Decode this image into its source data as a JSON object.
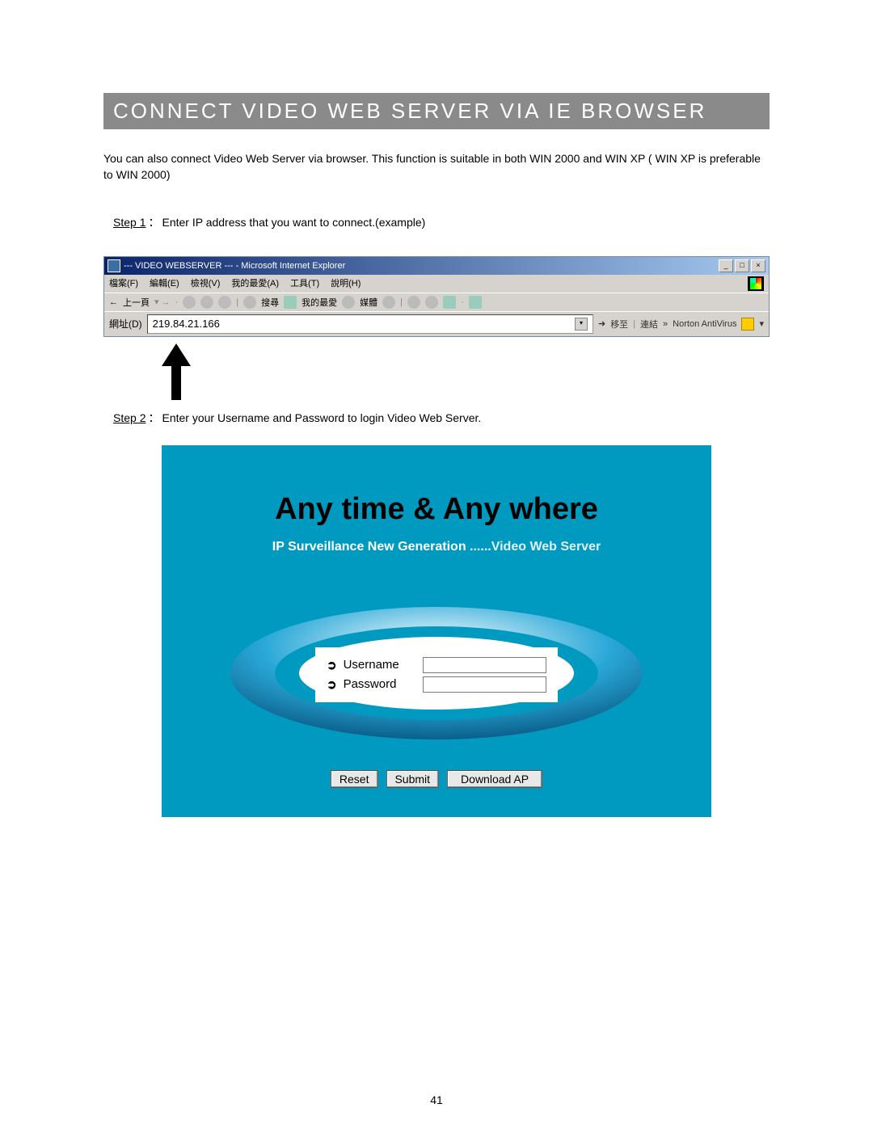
{
  "title": "CONNECT VIDEO WEB SERVER VIA IE BROWSER",
  "intro": "You can also connect Video Web Server via browser. This function is suitable in both WIN 2000 and WIN XP ( WIN XP is preferable to WIN 2000)",
  "step1_label": "Step 1",
  "step1_text": "Enter IP address that you want to connect.(example)",
  "step2_label": "Step 2",
  "step2_text": "Enter your Username and Password to login Video Web Server.",
  "ie": {
    "title": "--- VIDEO WEBSERVER --- - Microsoft Internet Explorer",
    "menus": [
      "檔案(F)",
      "編輯(E)",
      "檢視(V)",
      "我的最愛(A)",
      "工具(T)",
      "說明(H)"
    ],
    "toolbar": {
      "back": "上一頁",
      "search": "搜尋",
      "fav": "我的最愛",
      "media": "媒體"
    },
    "addr_label": "網址(D)",
    "addr_value": "219.84.21.166",
    "go": "移至",
    "links": "連結",
    "norton": "Norton AntiVirus"
  },
  "login": {
    "heading": "Any time & Any where",
    "sub1": "IP Surveillance New Generation ......",
    "sub2": "Video Web Server",
    "username": "Username",
    "password": "Password",
    "reset": "Reset",
    "submit": "Submit",
    "download": "Download AP"
  },
  "page_number": "41"
}
